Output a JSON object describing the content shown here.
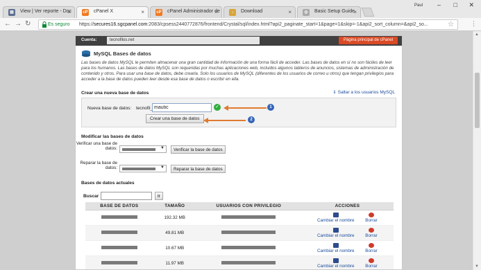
{
  "browser": {
    "tabs": [
      {
        "label": "View | Ver reporte - Doc",
        "icon": "document-icon",
        "color": "#5b6f8f"
      },
      {
        "label": "cPanel X",
        "icon": "cpanel-icon",
        "color": "#f07a22"
      },
      {
        "label": "cPanel Administrador de",
        "icon": "cpanel-icon",
        "color": "#f07a22"
      },
      {
        "label": "Download",
        "icon": "download-icon",
        "color": "#d8a53a"
      },
      {
        "label": "Basic Setup Guide",
        "icon": "page-icon",
        "color": "#a9a9a9"
      }
    ],
    "user": "Paul",
    "secure_label": "Es seguro",
    "url_prefix": "https://",
    "url_host": "secures16.sgcpanel.com",
    "url_path": ":2083/cpsess2440772876/frontend/Crystal/sql/index.html?api2_paginate_start=1&page=1&skip=-1&api2_sort_column=&api2_so..."
  },
  "cpanel": {
    "account_label": "Cuenta:",
    "domain": "tecnofilos.net",
    "home_button": "Página principal de cPanel"
  },
  "page": {
    "title": "MySQL Bases de datos",
    "description": "Las bases de datos MySQL le permiten almacenar una gran cantidad de información de una forma fácil de acceder. Las bases de datos en sí no son fáciles de leer para los humanos. Las bases de datos MySQL son requeridas por muchas aplicaciones web, incluidos algunos tableros de anuncios, sistemas de administración de contenido y otros. Para usar una base de datos, debe crearla. Solo los usuarios de MySQL (diferentes de los usuarios de correo u otros) que tengan privilegios para acceder a la base de datos pueden leer desde esa base de datos o escribir en ella."
  },
  "create": {
    "section_title": "Crear una nueva base de datos",
    "help_link": "Saltar a los usuarios MySQL",
    "field_label": "Nueva base de datos:",
    "prefix": "tecnofil_",
    "value": "mautic",
    "button": "Crear una base de datos",
    "annotation_1": "1",
    "annotation_2": "2"
  },
  "modify": {
    "section_title": "Modificar las bases de datos",
    "check_label": "Verificar una base de datos:",
    "check_button": "Verificar la base de datos",
    "repair_label": "Reparar la base de datos:",
    "repair_button": "Reparar la base de datos"
  },
  "current": {
    "section_title": "Bases de datos actuales",
    "search_label": "Buscar",
    "go_button": "Ir",
    "columns": [
      "Base de datos",
      "Tamaño",
      "Usuarios con privilegio",
      "Acciones"
    ],
    "rows": [
      {
        "size": "192.32 MB"
      },
      {
        "size": "49.81 MB"
      },
      {
        "size": "10.67 MB"
      },
      {
        "size": "11.97 MB"
      }
    ],
    "rename_label": "Cambiar el nombre",
    "delete_label": "Borrar"
  },
  "colors": {
    "accent_orange": "#d94a26",
    "annotation_arrow": "#e07a2f",
    "annotation_badge": "#3565b8",
    "valid_green": "#2fae3c"
  }
}
